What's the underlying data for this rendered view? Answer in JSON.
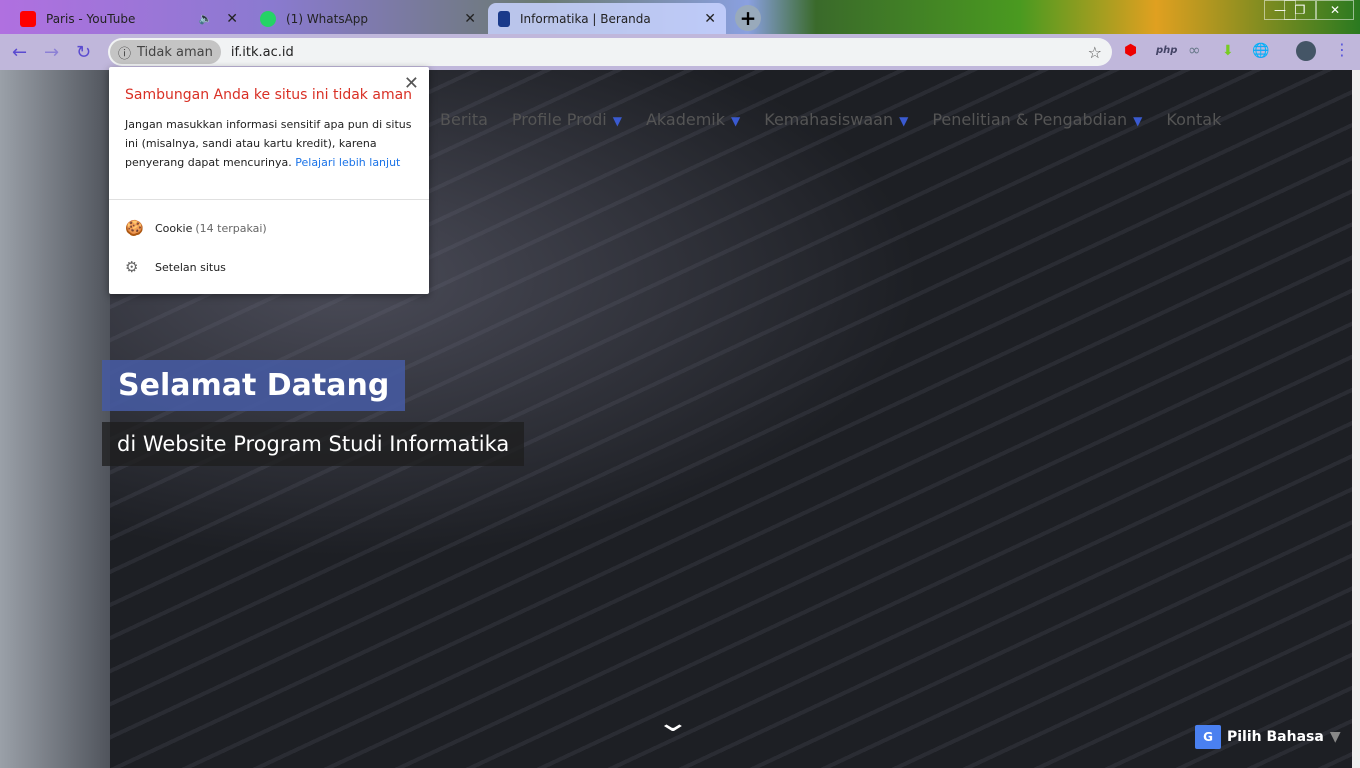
{
  "browser": {
    "tabs": [
      {
        "title": "Paris - YouTube",
        "active": false
      },
      {
        "title": "(1) WhatsApp",
        "active": false
      },
      {
        "title": "Informatika | Beranda",
        "active": true
      }
    ],
    "security_chip": "Tidak aman",
    "url": "if.itk.ac.id",
    "extensions": [
      "adblock-icon",
      "php",
      "infinity-icon",
      "download-icon",
      "globe-icon"
    ]
  },
  "popup": {
    "title": "Sambungan Anda ke situs ini tidak aman",
    "body": "Jangan masukkan informasi sensitif apa pun di situs ini (misalnya, sandi atau kartu kredit), karena penyerang dapat mencurinya.",
    "link": "Pelajari lebih lanjut",
    "cookie_label": "Cookie",
    "cookie_count": "(14 terpakai)",
    "settings_label": "Setelan situs"
  },
  "nav": [
    "Berita",
    "Profile Prodi",
    "Akademik",
    "Kemahasiswaan",
    "Penelitian & Pengabdian",
    "Kontak"
  ],
  "hero": {
    "title": "Selamat Datang",
    "subtitle": "di Website Program Studi Informatika"
  },
  "language": {
    "label": "Pilih Bahasa"
  },
  "colors": {
    "accent": "#3a5ad0",
    "warning": "#d93025",
    "link": "#1a73e8"
  }
}
